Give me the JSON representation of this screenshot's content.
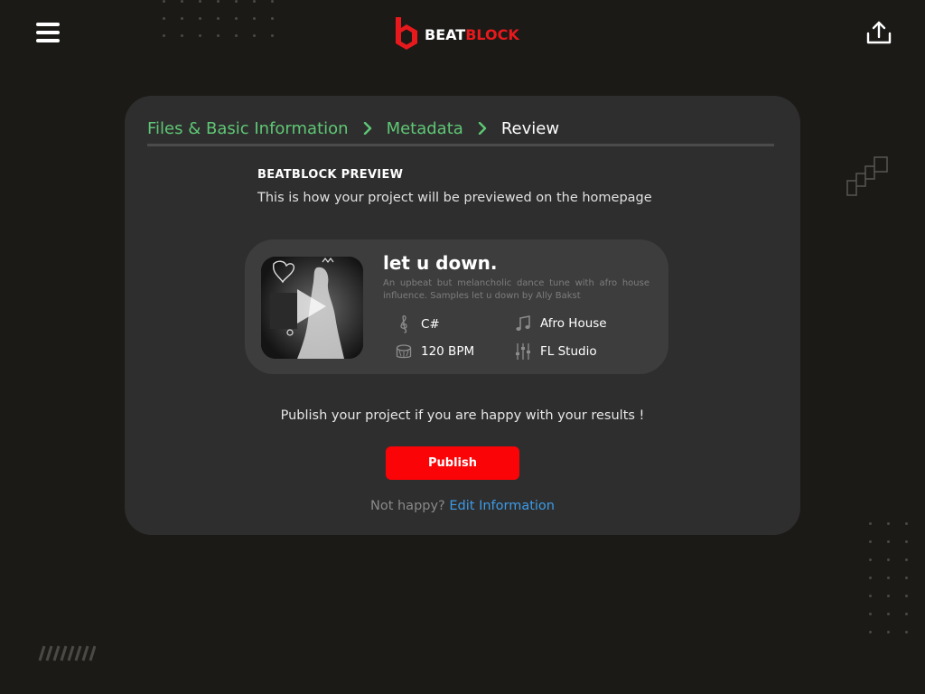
{
  "header": {
    "menu_icon": "hamburger-menu-icon",
    "logo": {
      "word1": "BEAT",
      "word2": "BLOCK",
      "brand_color": "#e8191c"
    },
    "upload_icon": "upload-icon"
  },
  "breadcrumb": {
    "steps": [
      {
        "label": "Files & Basic Information",
        "state": "done"
      },
      {
        "label": "Metadata",
        "state": "done"
      },
      {
        "label": "Review",
        "state": "current"
      }
    ],
    "done_color": "#5ec775"
  },
  "preview_section": {
    "title": "BEATBLOCK PREVIEW",
    "subtitle": "This is how your project will be previewed on the homepage"
  },
  "track": {
    "title": "let u down.",
    "description": "An upbeat but melancholic dance tune with afro house influence. Samples let u down by Ally Bakst",
    "key": "C#",
    "genre": "Afro House",
    "bpm": "120 BPM",
    "daw": "FL Studio",
    "icons": {
      "key": "treble-clef-icon",
      "genre": "music-note-icon",
      "bpm": "drum-icon",
      "daw": "mixer-sliders-icon",
      "play": "play-icon"
    }
  },
  "publish": {
    "note": "Publish your project if you are happy with your results !",
    "button_label": "Publish",
    "button_color": "#fb0407"
  },
  "edit": {
    "prefix": "Not happy?",
    "link": "Edit Information",
    "link_color": "#3b9be8"
  }
}
